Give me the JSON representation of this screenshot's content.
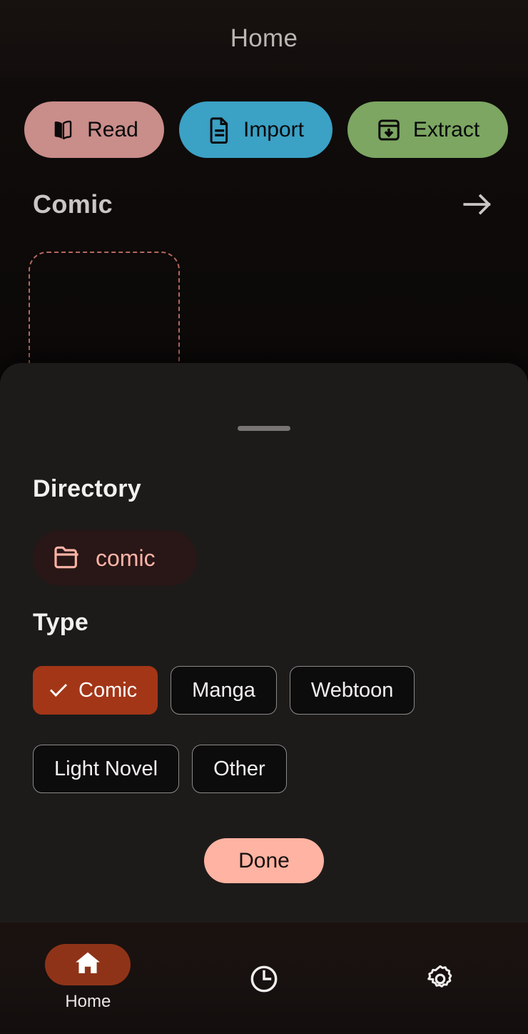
{
  "appbar": {
    "title": "Home"
  },
  "accent": {
    "read_pill": "#c98d8a",
    "import_pill": "#3ba1c5",
    "extract_pill": "#7ca662",
    "selected_chip": "#a33617",
    "done_button": "#ffb3a2",
    "directory_text": "#ffb3a7",
    "nav_active": "#8f3318",
    "placeholder_border": "#b4685e",
    "sheet_bg": "#1d1b1a"
  },
  "actions": [
    {
      "label": "Read",
      "icon": "open-book-icon"
    },
    {
      "label": "Import",
      "icon": "document-icon"
    },
    {
      "label": "Extract",
      "icon": "archive-download-icon"
    }
  ],
  "library": {
    "section_title": "Comic",
    "arrow_icon": "arrow-right-icon",
    "placeholder_card": ""
  },
  "sheet": {
    "handle": "drag-handle",
    "directory_label": "Directory",
    "directory_chip": {
      "name": "comic",
      "icon": "folder-icon"
    },
    "type_label": "Type",
    "type_options": [
      {
        "label": "Comic",
        "selected": true
      },
      {
        "label": "Manga",
        "selected": false
      },
      {
        "label": "Webtoon",
        "selected": false
      },
      {
        "label": "Light Novel",
        "selected": false
      },
      {
        "label": "Other",
        "selected": false
      }
    ],
    "done_label": "Done"
  },
  "bottomnav": [
    {
      "label": "Home",
      "icon": "home-icon",
      "active": true
    },
    {
      "label": "",
      "icon": "clock-icon",
      "active": false
    },
    {
      "label": "",
      "icon": "gear-icon",
      "active": false
    }
  ]
}
